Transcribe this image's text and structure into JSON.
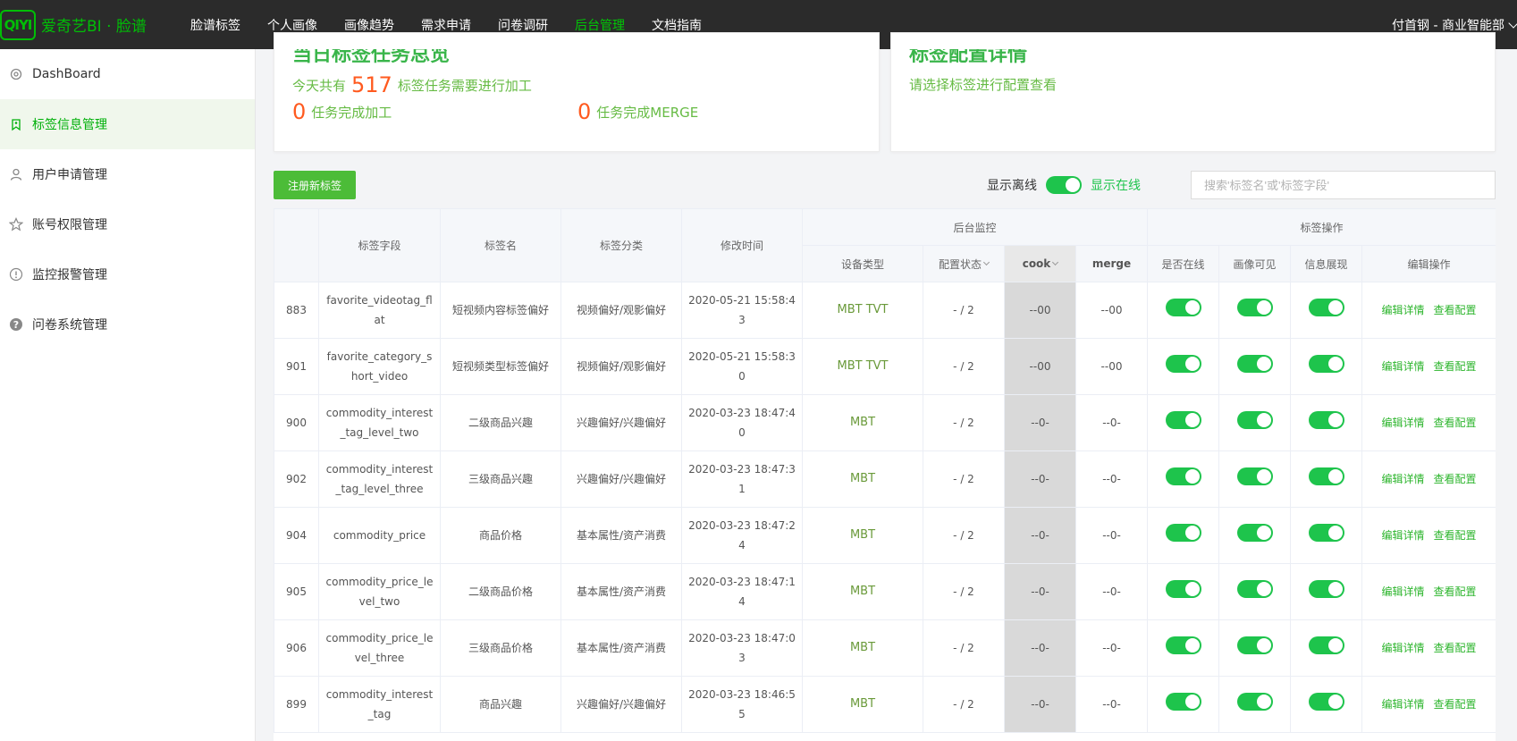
{
  "brand": {
    "logo_mark": "QIYI",
    "title": "爱奇艺BI · 脸谱"
  },
  "nav": [
    "脸谱标签",
    "个人画像",
    "画像趋势",
    "需求申请",
    "问卷调研",
    "后台管理",
    "文档指南"
  ],
  "nav_active_index": 5,
  "user_label": "付首钢 - 商业智能部",
  "sidebar": [
    {
      "label": "DashBoard",
      "icon": "gear-icon"
    },
    {
      "label": "标签信息管理",
      "icon": "tag-icon",
      "active": true
    },
    {
      "label": "用户申请管理",
      "icon": "user-icon"
    },
    {
      "label": "账号权限管理",
      "icon": "star-icon"
    },
    {
      "label": "监控报警管理",
      "icon": "alert-icon"
    },
    {
      "label": "问卷系统管理",
      "icon": "question-icon"
    }
  ],
  "summary": {
    "title": "当日标签任务总览",
    "prefix": "今天共有",
    "total": "517",
    "suffix": "标签任务需要进行加工",
    "processed_num": "0",
    "processed_label": "任务完成加工",
    "merge_num": "0",
    "merge_label": "任务完成MERGE"
  },
  "config": {
    "title": "标签配置详情",
    "subtitle": "请选择标签进行配置查看"
  },
  "toolbar": {
    "register_label": "注册新标签",
    "offline_label": "显示离线",
    "online_label": "显示在线",
    "search_placeholder": "搜索'标签名'或'标签字段'"
  },
  "table": {
    "headers": {
      "field": "标签字段",
      "name": "标签名",
      "category": "标签分类",
      "time": "修改时间",
      "monitor_group": "后台监控",
      "ops_group": "标签操作",
      "device": "设备类型",
      "config_status": "配置状态",
      "cook": "cook",
      "merge": "merge",
      "online": "是否在线",
      "portrait": "画像可见",
      "info": "信息展现",
      "edit": "编辑操作"
    },
    "edit_label": "编辑详情",
    "view_label": "查看配置",
    "rows": [
      {
        "id": "883",
        "field": "favorite_videotag_flat",
        "name": "短视频内容标签偏好",
        "category": "视频偏好/观影偏好",
        "time": "2020-05-21 15:58:43",
        "device": "MBT TVT",
        "status": "- / 2",
        "cook": "--00",
        "merge": "--00"
      },
      {
        "id": "901",
        "field": "favorite_category_short_video",
        "name": "短视频类型标签偏好",
        "category": "视频偏好/观影偏好",
        "time": "2020-05-21 15:58:30",
        "device": "MBT TVT",
        "status": "- / 2",
        "cook": "--00",
        "merge": "--00"
      },
      {
        "id": "900",
        "field": "commodity_interest_tag_level_two",
        "name": "二级商品兴趣",
        "category": "兴趣偏好/兴趣偏好",
        "time": "2020-03-23 18:47:40",
        "device": "MBT",
        "status": "- / 2",
        "cook": "--0-",
        "merge": "--0-"
      },
      {
        "id": "902",
        "field": "commodity_interest_tag_level_three",
        "name": "三级商品兴趣",
        "category": "兴趣偏好/兴趣偏好",
        "time": "2020-03-23 18:47:31",
        "device": "MBT",
        "status": "- / 2",
        "cook": "--0-",
        "merge": "--0-"
      },
      {
        "id": "904",
        "field": "commodity_price",
        "name": "商品价格",
        "category": "基本属性/资产消费",
        "time": "2020-03-23 18:47:24",
        "device": "MBT",
        "status": "- / 2",
        "cook": "--0-",
        "merge": "--0-"
      },
      {
        "id": "905",
        "field": "commodity_price_level_two",
        "name": "二级商品价格",
        "category": "基本属性/资产消费",
        "time": "2020-03-23 18:47:14",
        "device": "MBT",
        "status": "- / 2",
        "cook": "--0-",
        "merge": "--0-"
      },
      {
        "id": "906",
        "field": "commodity_price_level_three",
        "name": "三级商品价格",
        "category": "基本属性/资产消费",
        "time": "2020-03-23 18:47:03",
        "device": "MBT",
        "status": "- / 2",
        "cook": "--0-",
        "merge": "--0-"
      },
      {
        "id": "899",
        "field": "commodity_interest_tag",
        "name": "商品兴趣",
        "category": "兴趣偏好/兴趣偏好",
        "time": "2020-03-23 18:46:55",
        "device": "MBT",
        "status": "- / 2",
        "cook": "--0-",
        "merge": "--0-"
      }
    ]
  },
  "colors": {
    "brand_green": "#00be06",
    "nav_bg": "#2b2b2b",
    "switch_on": "#1ec44c",
    "number_orange": "#ff5a1f"
  }
}
